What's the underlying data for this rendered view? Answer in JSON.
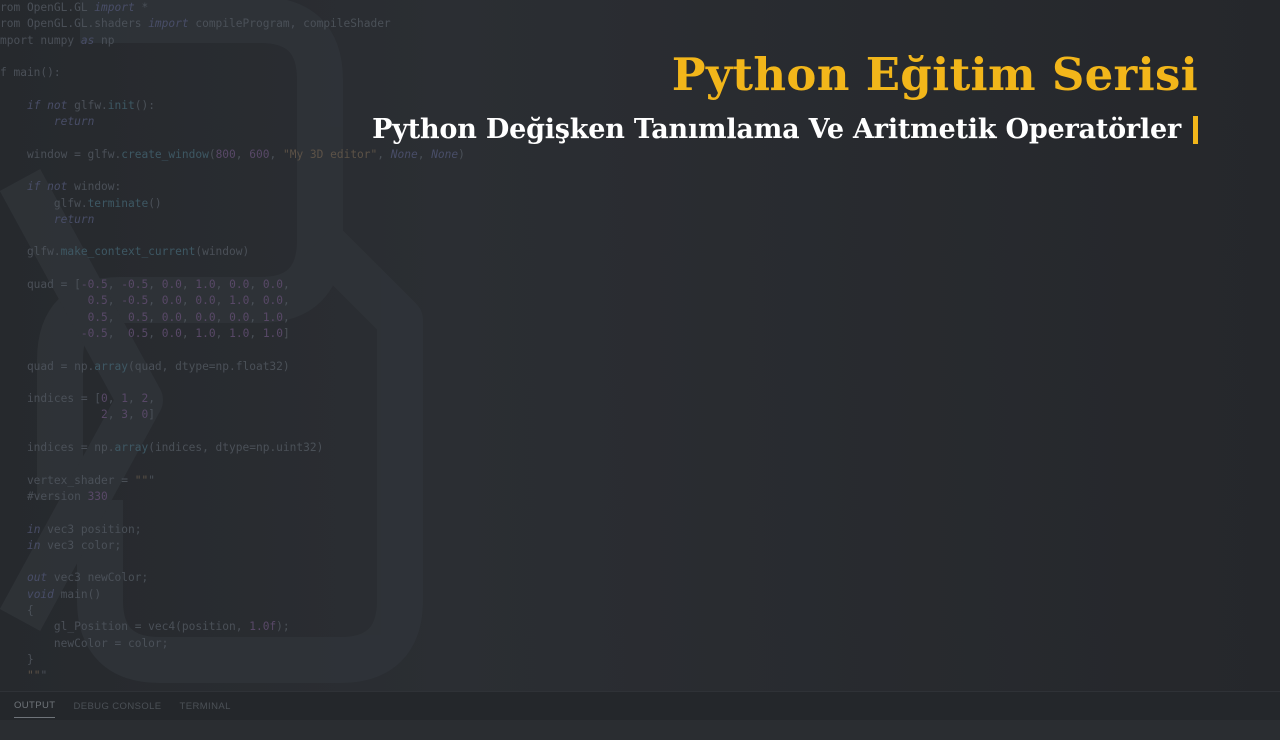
{
  "title": "Python Eğitim Serisi",
  "subtitle": "Python Değişken Tanımlama Ve Aritmetik Operatörler",
  "colors": {
    "accent": "#f2b61a",
    "subtitle": "#ffffff",
    "background": "#2a2d31"
  },
  "code_lines": [
    "rom OpenGL.GL import *",
    "rom OpenGL.GL.shaders import compileProgram, compileShader",
    "mport numpy as np",
    "",
    "f main():",
    "",
    "    if not glfw.init():",
    "        return",
    "",
    "    window = glfw.create_window(800, 600, \"My 3D editor\", None, None)",
    "",
    "    if not window:",
    "        glfw.terminate()",
    "        return",
    "",
    "    glfw.make_context_current(window)",
    "",
    "    quad = [-0.5, -0.5, 0.0, 1.0, 0.0, 0.0,",
    "             0.5, -0.5, 0.0, 0.0, 1.0, 0.0,",
    "             0.5,  0.5, 0.0, 0.0, 0.0, 1.0,",
    "            -0.5,  0.5, 0.0, 1.0, 1.0, 1.0]",
    "",
    "    quad = np.array(quad, dtype=np.float32)",
    "",
    "    indices = [0, 1, 2,",
    "               2, 3, 0]",
    "",
    "    indices = np.array(indices, dtype=np.uint32)",
    "",
    "    vertex_shader = \"\"\"",
    "    #version 330",
    "",
    "    in vec3 position;",
    "    in vec3 color;",
    "",
    "    out vec3 newColor;",
    "    void main()",
    "    {",
    "        gl_Position = vec4(position, 1.0f);",
    "        newColor = color;",
    "    }",
    "    \"\"\""
  ],
  "panel_tabs": [
    "OUTPUT",
    "DEBUG CONSOLE",
    "TERMINAL"
  ],
  "active_panel_tab": "OUTPUT"
}
